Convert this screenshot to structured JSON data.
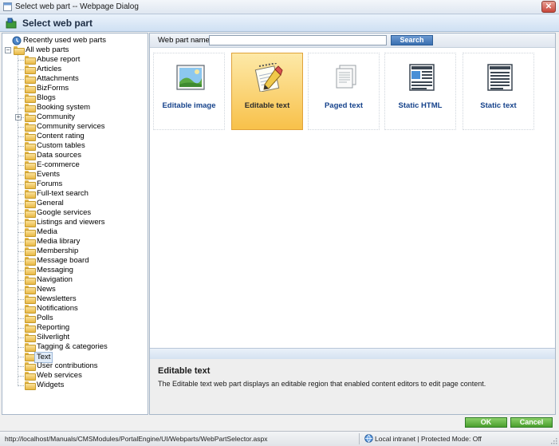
{
  "window": {
    "title": "Select web part -- Webpage Dialog",
    "close_glyph": "✕"
  },
  "header": {
    "title": "Select web part",
    "icon": "webpart-puzzle-icon"
  },
  "tree": {
    "recent_label": "Recently used web parts",
    "all_label": "All web parts",
    "all_expander": "−",
    "categories": [
      "Abuse report",
      "Articles",
      "Attachments",
      "BizForms",
      "Blogs",
      "Booking system",
      "Community",
      "Community services",
      "Content rating",
      "Custom tables",
      "Data sources",
      "E-commerce",
      "Events",
      "Forums",
      "Full-text search",
      "General",
      "Google services",
      "Listings and viewers",
      "Media",
      "Media library",
      "Membership",
      "Message board",
      "Messaging",
      "Navigation",
      "News",
      "Newsletters",
      "Notifications",
      "Polls",
      "Reporting",
      "Silverlight",
      "Tagging & categories",
      "Text",
      "User contributions",
      "Web services",
      "Widgets"
    ],
    "expandable_category": "Community",
    "expandable_glyph": "+",
    "selected_category": "Text"
  },
  "search": {
    "label": "Web part name:",
    "value": "",
    "placeholder": "",
    "button_label": "Search"
  },
  "webparts": [
    {
      "label": "Editable image",
      "icon": "image-landscape-icon",
      "selected": false
    },
    {
      "label": "Editable text",
      "icon": "notepad-pencil-icon",
      "selected": true
    },
    {
      "label": "Paged text",
      "icon": "pages-stack-icon",
      "selected": false
    },
    {
      "label": "Static HTML",
      "icon": "html-layout-icon",
      "selected": false
    },
    {
      "label": "Static text",
      "icon": "text-lines-icon",
      "selected": false
    }
  ],
  "description": {
    "title": "Editable text",
    "text": "The Editable text web part displays an editable region that enabled content editors to edit page content."
  },
  "buttons": {
    "ok": "OK",
    "cancel": "Cancel"
  },
  "status": {
    "url": "http://localhost/Manuals/CMSModules/PortalEngine/UI/Webparts/WebPartSelector.aspx",
    "zone": "Local intranet | Protected Mode: Off"
  },
  "colors": {
    "selected_card": "#f8c14a",
    "link_blue": "#15428b",
    "button_green": "#4a9f2d",
    "search_blue": "#3a6fb0"
  }
}
